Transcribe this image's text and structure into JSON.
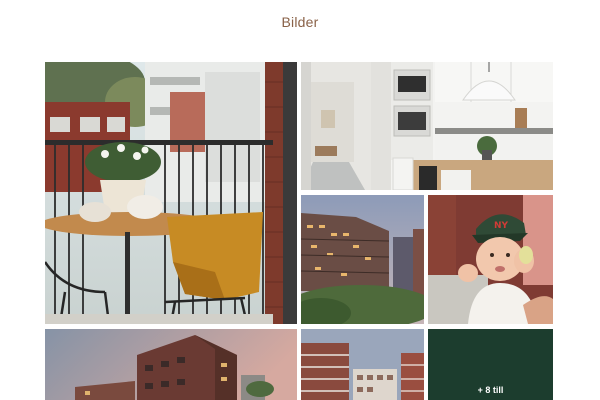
{
  "section": {
    "title": "Bilder"
  },
  "gallery": {
    "images": [
      {
        "subject": "balcony-with-table-and-chairs"
      },
      {
        "subject": "white-kitchen-interior"
      },
      {
        "subject": "apartment-buildings-dusk"
      },
      {
        "subject": "baby-with-cap"
      },
      {
        "subject": "building-exterior-sunset"
      },
      {
        "subject": "apartment-facade-courtyard"
      }
    ],
    "more_button": {
      "label": "+ 8 till",
      "color": "#1c3d2e"
    }
  },
  "colors": {
    "title": "#8a6248",
    "accent_dark_green": "#1c3d2e"
  }
}
